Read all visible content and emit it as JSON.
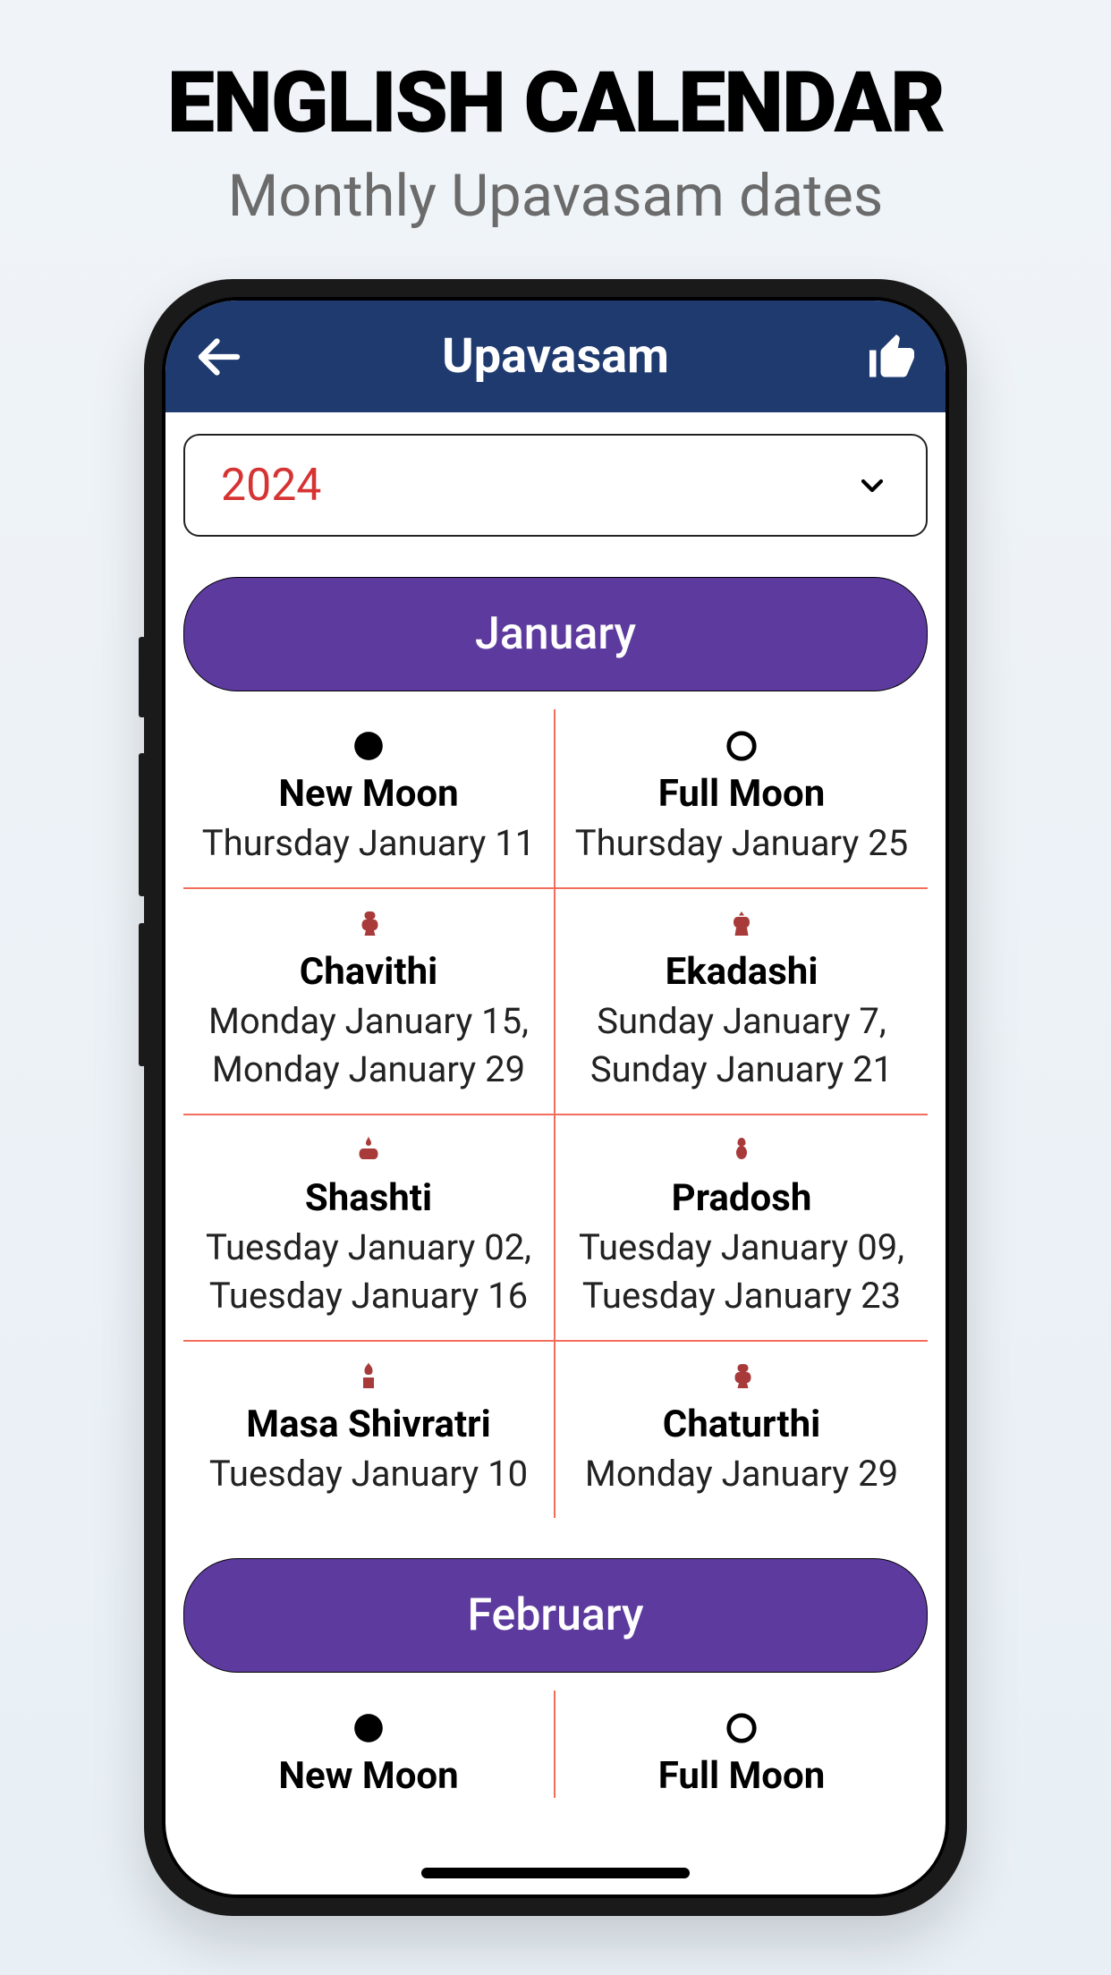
{
  "promo": {
    "title": "ENGLISH CALENDAR",
    "subtitle": "Monthly Upavasam dates"
  },
  "header": {
    "title": "Upavasam"
  },
  "year": "2024",
  "months": [
    {
      "name": "January",
      "events": [
        {
          "icon": "moon-filled",
          "name": "New Moon",
          "dates": "Thursday January 11"
        },
        {
          "icon": "moon-outline",
          "name": "Full Moon",
          "dates": "Thursday January 25"
        },
        {
          "icon": "deity",
          "name": "Chavithi",
          "dates": "Monday January 15,\nMonday January 29"
        },
        {
          "icon": "deity",
          "name": "Ekadashi",
          "dates": "Sunday January 7,\nSunday January 21"
        },
        {
          "icon": "deity",
          "name": "Shashti",
          "dates": "Tuesday January 02,\nTuesday January 16"
        },
        {
          "icon": "deity",
          "name": "Pradosh",
          "dates": "Tuesday January 09,\nTuesday January 23"
        },
        {
          "icon": "deity",
          "name": "Masa Shivratri",
          "dates": "Tuesday January 10"
        },
        {
          "icon": "deity",
          "name": "Chaturthi",
          "dates": "Monday January 29"
        }
      ]
    },
    {
      "name": "February",
      "events": [
        {
          "icon": "moon-filled",
          "name": "New Moon",
          "dates": ""
        },
        {
          "icon": "moon-outline",
          "name": "Full Moon",
          "dates": ""
        }
      ]
    }
  ]
}
